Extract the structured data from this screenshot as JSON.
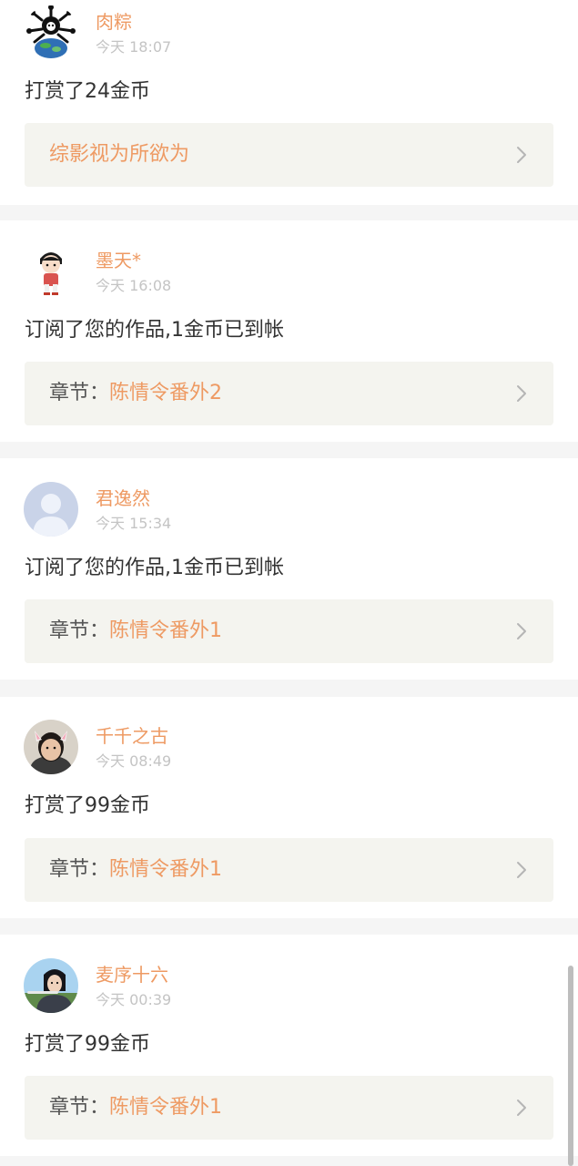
{
  "notifications": [
    {
      "user": "肉粽",
      "time": "今天 18:07",
      "message": "打赏了24金币",
      "link_prefix": "",
      "link_title": "综影视为所欲为"
    },
    {
      "user": "墨天*",
      "time": "今天 16:08",
      "message": "订阅了您的作品,1金币已到帐",
      "link_prefix": "章节：",
      "link_title": "陈情令番外2"
    },
    {
      "user": "君逸然",
      "time": "今天 15:34",
      "message": "订阅了您的作品,1金币已到帐",
      "link_prefix": "章节：",
      "link_title": "陈情令番外1"
    },
    {
      "user": "千千之古",
      "time": "今天 08:49",
      "message": "打赏了99金币",
      "link_prefix": "章节：",
      "link_title": "陈情令番外1"
    },
    {
      "user": "麦序十六",
      "time": "今天 00:39",
      "message": "打赏了99金币",
      "link_prefix": "章节：",
      "link_title": "陈情令番外1"
    }
  ],
  "icons": {
    "chevron": "chevron-right-icon"
  },
  "colors": {
    "accent": "#ee9a63",
    "text": "#333333",
    "time": "#c4c4c4",
    "link_bg": "#f4f4ef",
    "separator": "#f5f5f5"
  }
}
